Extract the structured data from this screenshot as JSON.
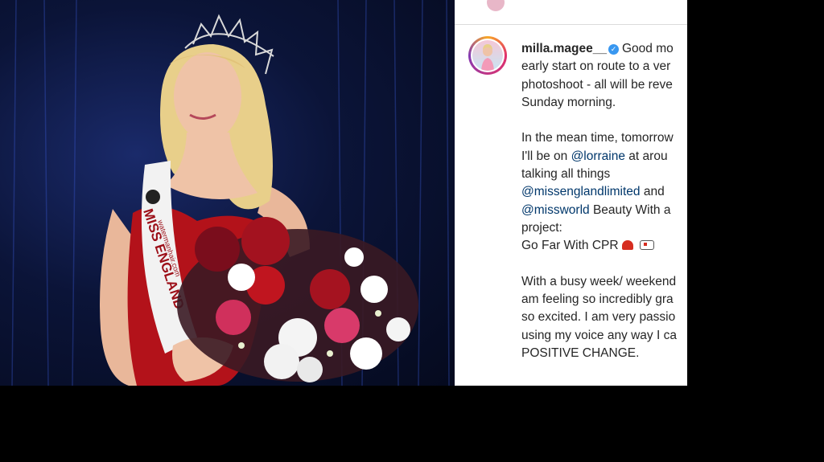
{
  "post": {
    "username": "milla.magee__",
    "caption_lines": [
      "Good mo",
      "early start on route to a ver",
      "photoshoot - all will be reve",
      "Sunday morning.",
      "",
      "In the mean time, tomorrow",
      "I'll be on ",
      "@lorraine",
      " at arou",
      "talking all things",
      "@missenglandlimited",
      " and",
      "@missworld",
      " Beauty With a",
      "project:",
      "Go Far With CPR",
      "",
      "With a busy week/ weekend",
      "am feeling so incredibly gra",
      "so excited. I am very passio",
      "using my voice any way I ca",
      "POSITIVE CHANGE."
    ]
  },
  "photo": {
    "sash_text": "MISS ENGLAND",
    "sash_url": "watermanhair.com"
  },
  "icons": [
    "verified-badge-icon",
    "siren-icon",
    "ambulance-icon"
  ],
  "colors": {
    "background": "#000000",
    "panel": "#ffffff",
    "text": "#262626",
    "mention": "#00376b",
    "verified": "#3897f0"
  }
}
